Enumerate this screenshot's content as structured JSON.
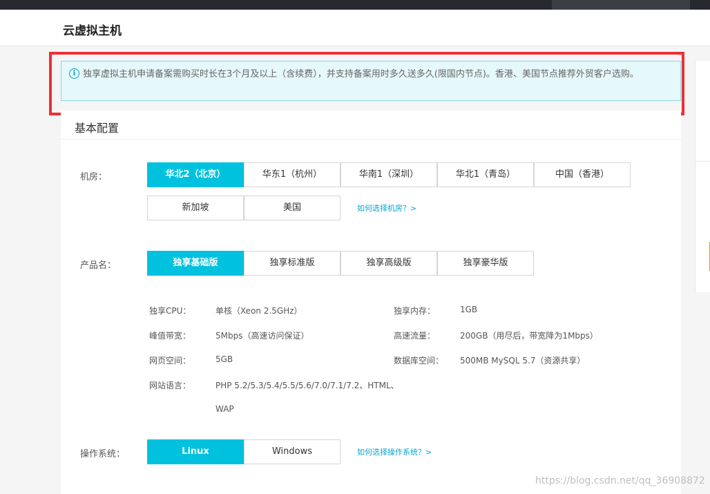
{
  "page": {
    "title": "云虚拟主机"
  },
  "notice": {
    "icon": "info-icon",
    "text": "独享虚拟主机申请备案需购买时长在3个月及以上（含续费），并支持备案用时多久送多久(限国内节点)。香港、美国节点推荐外贸客户选购。"
  },
  "basic_config": {
    "title": "基本配置",
    "datacenter": {
      "label": "机房：",
      "options": [
        "华北2（北京）",
        "华东1（杭州）",
        "华南1（深圳）",
        "华北1（青岛）",
        "中国（香港）",
        "新加坡",
        "美国"
      ],
      "selected": "华北2（北京）",
      "help": "如何选择机房？>"
    },
    "product": {
      "label": "产品名：",
      "options": [
        "独享基础版",
        "独享标准版",
        "独享高级版",
        "独享豪华版"
      ],
      "selected": "独享基础版"
    },
    "specs": {
      "cpu_label": "独享CPU：",
      "cpu_value": "单核（Xeon 2.5GHz）",
      "mem_label": "独享内存：",
      "mem_value": "1GB",
      "bw_label": "峰值带宽：",
      "bw_value": "5Mbps（高速访问保证）",
      "traffic_label": "高速流量：",
      "traffic_value": "200GB（用尽后，带宽降为1Mbps）",
      "web_label": "网页空间：",
      "web_value": "5GB",
      "db_label": "数据库空间：",
      "db_value": "500MB MySQL 5.7（资源共享）",
      "lang_label": "网站语言：",
      "lang_value_line1": "PHP 5.2/5.3/5.4/5.5/5.6/7.0/7.1/7.2、HTML、",
      "lang_value_line2": "WAP"
    },
    "os": {
      "label": "操作系统：",
      "options": [
        "Linux",
        "Windows"
      ],
      "selected": "Linux",
      "help": "如何选择操作系统？>"
    }
  },
  "colors": {
    "accent": "#00c1de",
    "highlight": "#ee2f35",
    "link": "#0aa4cf",
    "notice_bg": "#e5f8fb"
  },
  "watermark": "https://blog.csdn.net/qq_36908872"
}
